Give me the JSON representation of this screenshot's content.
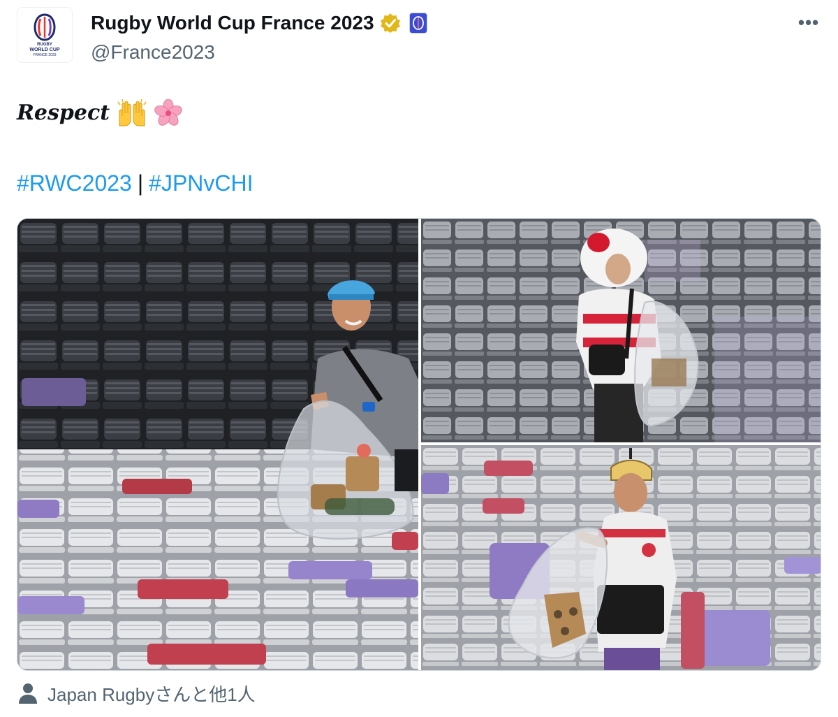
{
  "account": {
    "display_name": "Rugby World Cup France 2023",
    "handle": "@France2023",
    "avatar_logo_text": [
      "RUGBY",
      "WORLD CUP",
      "FRANCE 2023"
    ],
    "verified_badge_color": "#e2b719",
    "affiliate_badge_color": "#3a4bd6"
  },
  "tweet": {
    "text": "Respect",
    "emojis": [
      "raising-hands-emoji",
      "cherry-blossom-emoji"
    ],
    "hashtags": [
      "#RWC2023",
      "#JPNvCHI"
    ],
    "hashtag_separator": "|",
    "hashtag_color": "#1d9bf0"
  },
  "media": {
    "photos": [
      {
        "subject": "fan-blue-cap-collecting-trash"
      },
      {
        "subject": "fan-red-white-wig-collecting-trash"
      },
      {
        "subject": "fan-samurai-helmet-collecting-trash"
      }
    ]
  },
  "tagged": {
    "text": "Japan Rugbyさんと他1人"
  },
  "menu": {
    "more_label": "•••"
  }
}
